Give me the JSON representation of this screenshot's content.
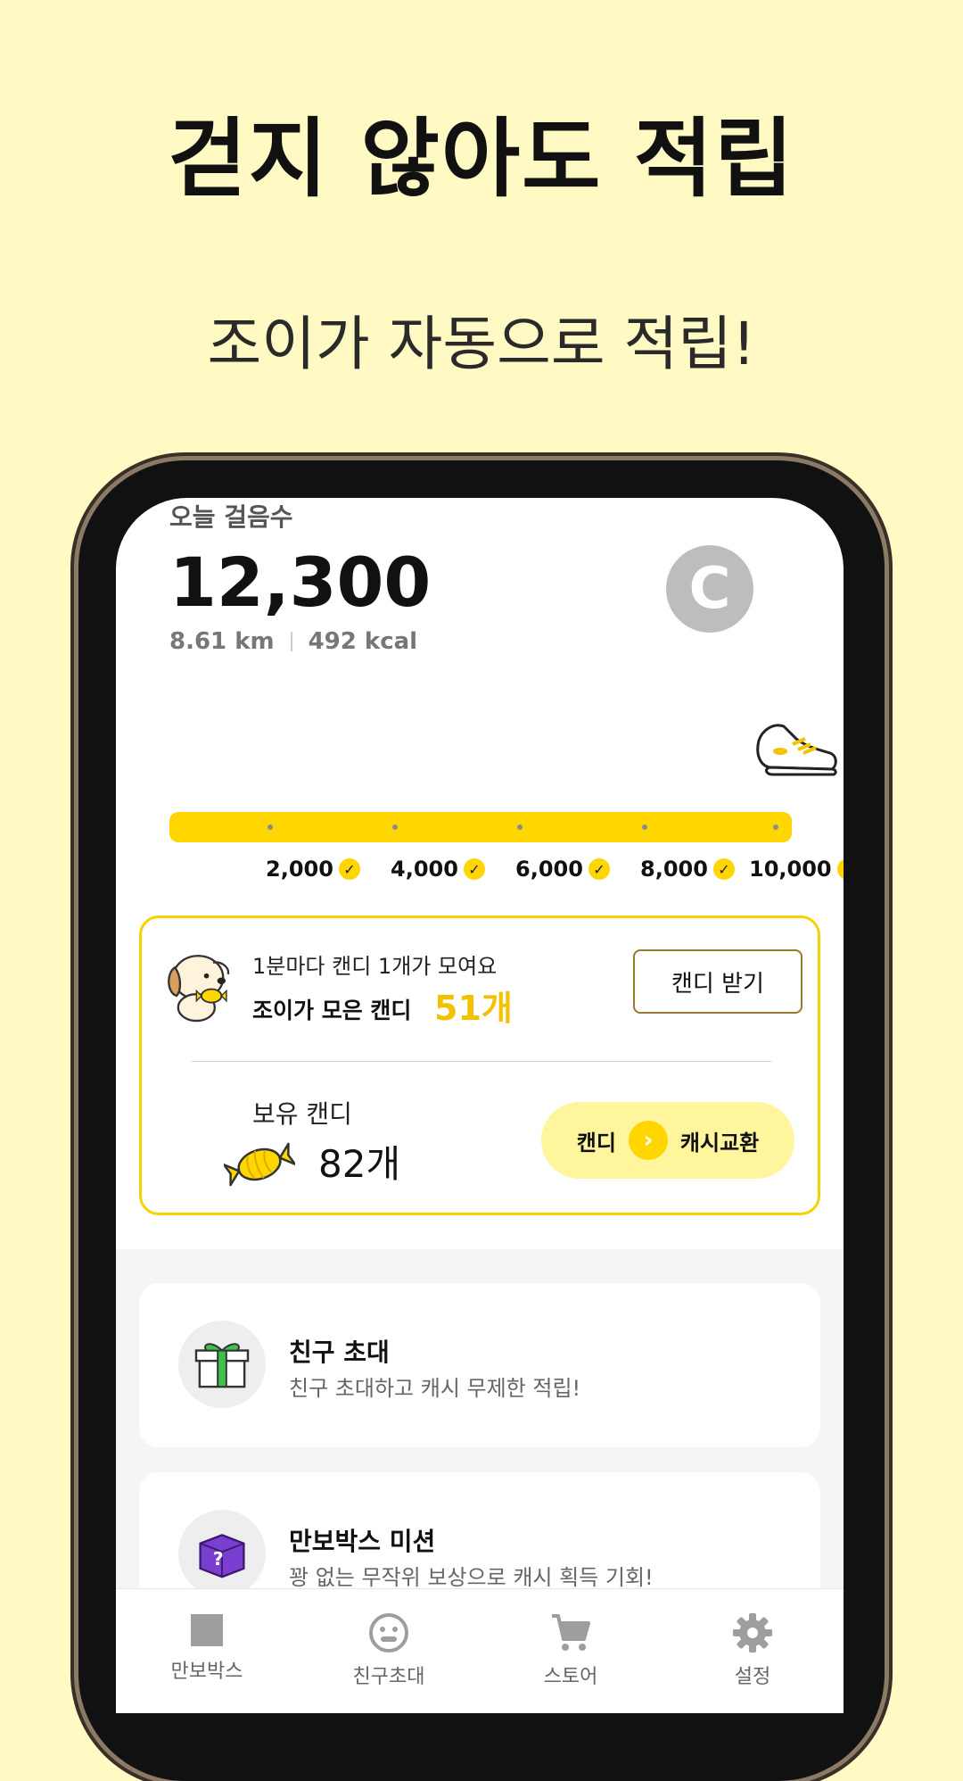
{
  "promo": {
    "headline": "걷지 않아도 적립",
    "subhead": "조이가 자동으로 적립!"
  },
  "steps": {
    "label": "오늘 걸음수",
    "value": "12,300",
    "distance": "8.61 km",
    "calories": "492 kcal",
    "logo_letter": "C",
    "progress_fraction": 1.0
  },
  "milestones": [
    "2,000",
    "4,000",
    "6,000",
    "8,000",
    "10,000"
  ],
  "candy": {
    "note": "1분마다 캔디 1개가 모여요",
    "collected_label": "조이가 모은 캔디",
    "collected_value": "51개",
    "receive_button": "캔디 받기",
    "owned_label": "보유 캔디",
    "owned_value": "82개",
    "exchange_from": "캔디",
    "exchange_to": "캐시교환"
  },
  "missions": [
    {
      "title": "친구 초대",
      "desc": "친구 초대하고 캐시 무제한 적립!",
      "icon": "gift-box-icon"
    },
    {
      "title": "만보박스 미션",
      "desc": "꽝 없는 무작위 보상으로 캐시 획득 기회!",
      "icon": "mystery-box-icon"
    }
  ],
  "nav": [
    {
      "label": "만보박스",
      "icon": "box-icon"
    },
    {
      "label": "친구초대",
      "icon": "smiley-icon"
    },
    {
      "label": "스토어",
      "icon": "cart-icon"
    },
    {
      "label": "설정",
      "icon": "gear-icon"
    }
  ],
  "colors": {
    "background": "#fff9c4",
    "accent": "#ffd600",
    "candy_value": "#f2c200"
  }
}
